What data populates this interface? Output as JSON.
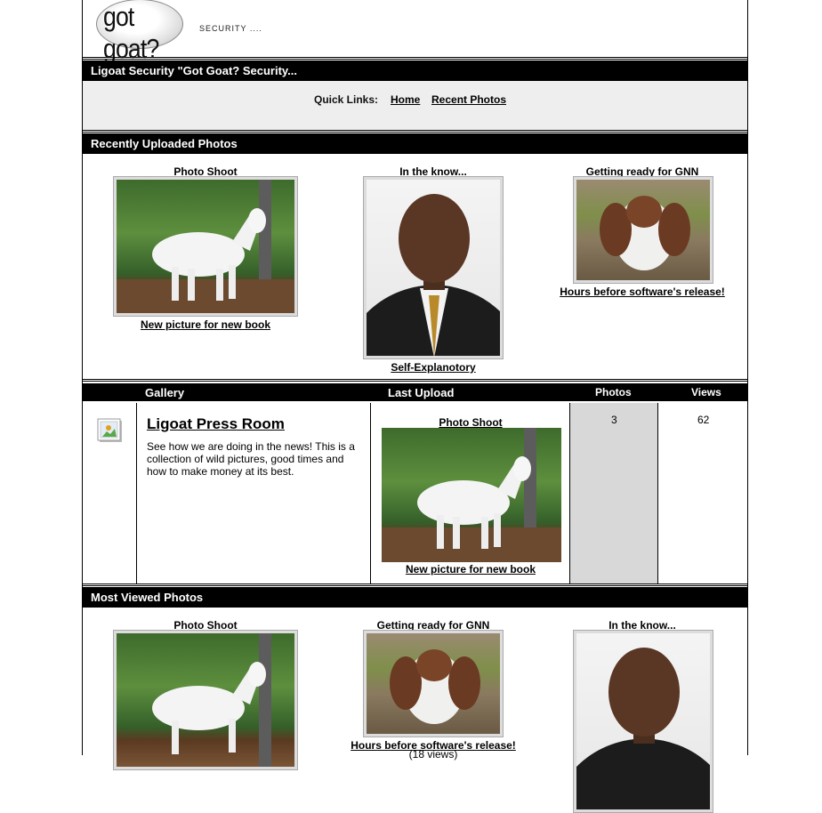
{
  "header": {
    "logo_text": "got goat?",
    "tagline": "SECURITY ...."
  },
  "title_bar": "Ligoat Security \"Got Goat? Security...",
  "quick_links": {
    "label": "Quick Links:",
    "links": [
      "Home",
      "Recent Photos"
    ]
  },
  "recent": {
    "heading": "Recently Uploaded Photos",
    "items": [
      {
        "title": "Photo Shoot",
        "caption": "New picture for new book",
        "photo": "white-goat"
      },
      {
        "title": "In the know...",
        "caption": "Self-Explanotory",
        "photo": "man-portrait"
      },
      {
        "title": "Getting ready for GNN",
        "caption": "Hours before software's release!",
        "photo": "brown-goat"
      }
    ]
  },
  "gallery_table": {
    "headers": {
      "gallery": "Gallery",
      "last_upload": "Last Upload",
      "photos": "Photos",
      "views": "Views"
    },
    "row": {
      "icon": "gallery-image-icon",
      "name": "Ligoat Press Room",
      "description": "See how we are doing in the news! This is a collection of wild pictures, good times and how to make money at its best.",
      "last_title": "Photo Shoot",
      "last_caption": "New picture for new book",
      "photos": "3",
      "views": "62"
    }
  },
  "most_viewed": {
    "heading": "Most Viewed Photos",
    "items": [
      {
        "title": "Photo Shoot",
        "photo": "white-goat"
      },
      {
        "title": "Getting ready for GNN",
        "caption": "Hours before software's release!",
        "views": "(18 views)",
        "photo": "brown-goat"
      },
      {
        "title": "In the know...",
        "photo": "man-portrait"
      }
    ]
  }
}
